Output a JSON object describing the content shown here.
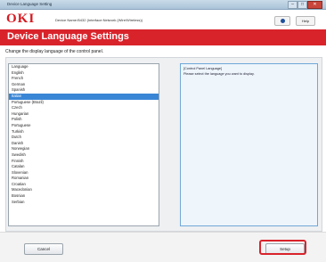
{
  "window": {
    "title": "Device Language Setting",
    "controls": [
      "–",
      "□",
      "✕"
    ]
  },
  "header": {
    "logo": "OKI",
    "device_name": "Device Name:B432 (Interface:Network (Wire/Wireless))",
    "help_label": "Help"
  },
  "banner": {
    "title": "Device Language Settings"
  },
  "instruction": "Change the display language of the control panel.",
  "languages": {
    "header": "Language",
    "items": [
      "English",
      "French",
      "German",
      "Spanish",
      "Italian",
      "Portuguese (Brazil)",
      "Czech",
      "Hungarian",
      "Polish",
      "Portuguese",
      "Turkish",
      "Dutch",
      "Danish",
      "Norwegian",
      "Swedish",
      "Finnish",
      "Catalan",
      "Slovenian",
      "Romanian",
      "Croatian",
      "Macedonian",
      "Bosnian",
      "Serbian"
    ],
    "selected_index": 4
  },
  "description": {
    "title": "[Control Panel Language]",
    "text": "Please select the language you want to display."
  },
  "footer": {
    "cancel_label": "Cancel",
    "setup_label": "Setup"
  },
  "colors": {
    "brand_red": "#d9232b",
    "selection_blue": "#3a86d6"
  }
}
